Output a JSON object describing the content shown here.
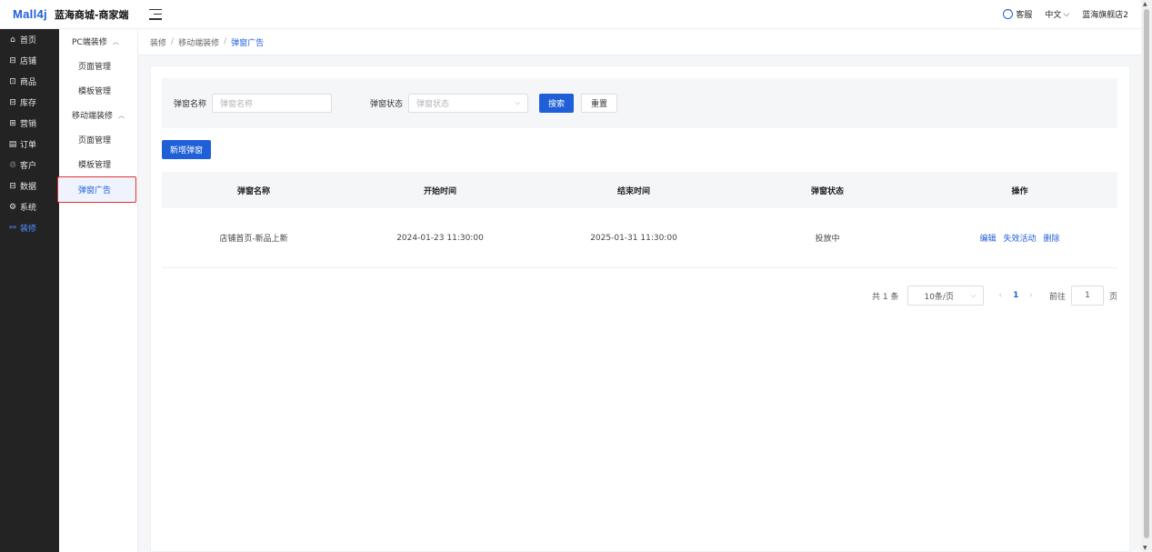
{
  "header": {
    "logo": "Mall4j",
    "title": "蓝海商城-商家端",
    "service": "客服",
    "language": "中文",
    "store": "蓝海旗舰店2"
  },
  "sidebar": {
    "items": [
      {
        "icon": "home-icon",
        "glyph": "⌂",
        "label": "首页"
      },
      {
        "icon": "store-icon",
        "glyph": "⊟",
        "label": "店铺"
      },
      {
        "icon": "goods-icon",
        "glyph": "⊡",
        "label": "商品"
      },
      {
        "icon": "stock-icon",
        "glyph": "⊟",
        "label": "库存"
      },
      {
        "icon": "marketing-icon",
        "glyph": "⊞",
        "label": "营销"
      },
      {
        "icon": "order-icon",
        "glyph": "▤",
        "label": "订单"
      },
      {
        "icon": "customer-icon",
        "glyph": "♲",
        "label": "客户"
      },
      {
        "icon": "data-icon",
        "glyph": "⊟",
        "label": "数据"
      },
      {
        "icon": "system-icon",
        "glyph": "⚙",
        "label": "系统"
      },
      {
        "icon": "decorate-icon",
        "glyph": "⚯",
        "label": "装修"
      }
    ]
  },
  "submenu": {
    "pc_group": "PC端装修",
    "pc_items": [
      "页面管理",
      "模板管理"
    ],
    "mobile_group": "移动端装修",
    "mobile_items": [
      "页面管理",
      "模板管理",
      "弹窗广告"
    ]
  },
  "breadcrumb": [
    "装修",
    "移动端装修",
    "弹窗广告"
  ],
  "search": {
    "name_label": "弹窗名称",
    "name_placeholder": "弹窗名称",
    "status_label": "弹窗状态",
    "status_placeholder": "弹窗状态",
    "search_button": "搜索",
    "reset_button": "重置"
  },
  "add_button": "新增弹窗",
  "table": {
    "columns": [
      "弹窗名称",
      "开始时间",
      "结束时间",
      "弹窗状态",
      "操作"
    ],
    "rows": [
      {
        "name": "店铺首页-新品上新",
        "start": "2024-01-23 11:30:00",
        "end": "2025-01-31 11:30:00",
        "status": "投放中",
        "ops": [
          "编辑",
          "失效活动",
          "删除"
        ]
      }
    ]
  },
  "pagination": {
    "total": "共 1 条",
    "page_size": "10条/页",
    "current": "1",
    "goto_label": "前往",
    "goto_value": "1",
    "page_unit": "页"
  },
  "colors": {
    "primary": "#1f60d8",
    "sidebar_bg": "#232323",
    "highlight_border": "#e0302b"
  }
}
